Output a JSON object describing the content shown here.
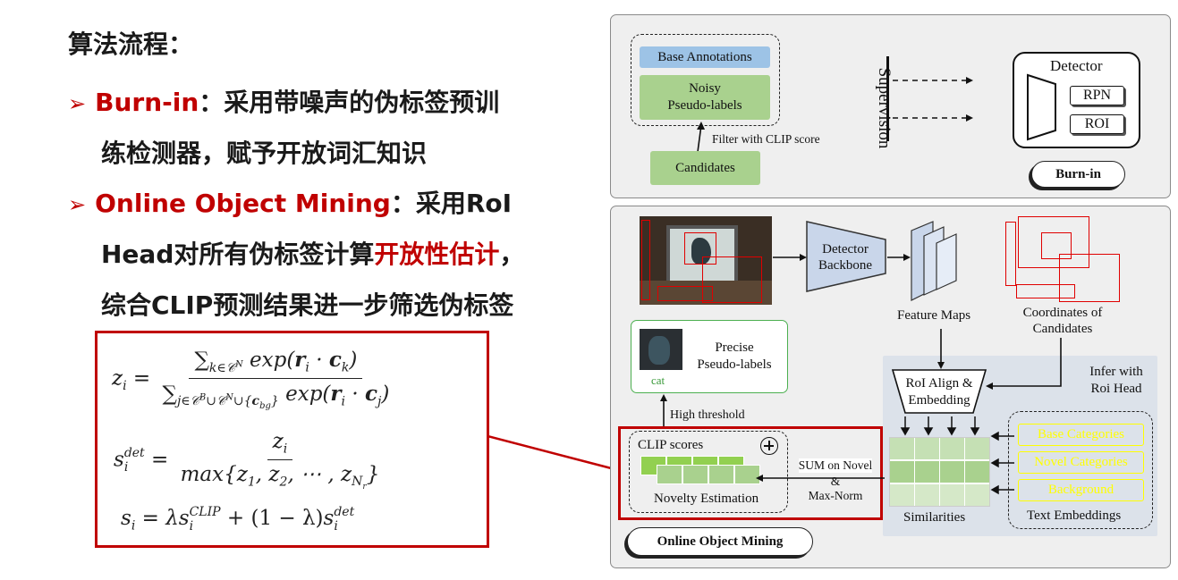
{
  "left": {
    "title": "算法流程：",
    "bullet1": {
      "highlight": "Burn-in",
      "rest": "：采用带噪声的伪标签预训",
      "line2": "练检测器，赋予开放词汇知识"
    },
    "bullet2": {
      "highlight": "Online Object Mining",
      "rest": "：采用RoI",
      "line2_pre": "Head对所有伪标签计算",
      "line2_red": "开放性估计",
      "line2_post": "，",
      "line3": "综合CLIP预测结果进一步筛选伪标签"
    }
  },
  "formulas": {
    "z_lhs": "z",
    "z_num": "exp(",
    "z_den": "exp(",
    "sdet_lhs": "s",
    "sdet_num": "z",
    "sdet_den": "max{z",
    "s_lhs": "s",
    "lambda": "λ",
    "one_minus_lambda": "(1 − λ)"
  },
  "burnin": {
    "base_annotations": "Base Annotations",
    "noisy_line1": "Noisy",
    "noisy_line2": "Pseudo-labels",
    "filter": "Filter with CLIP score",
    "candidates": "Candidates",
    "supervision": "Supervision",
    "detector": "Detector",
    "rpn": "RPN",
    "roi": "ROI",
    "label": "Burn-in"
  },
  "mining": {
    "detector_backbone_line1": "Detector",
    "detector_backbone_line2": "Backbone",
    "feature_maps": "Feature Maps",
    "coords_line1": "Coordinates of",
    "coords_line2": "Candidates",
    "precise_line1": "Precise",
    "precise_line2": "Pseudo-labels",
    "cat": "cat",
    "high_threshold": "High threshold",
    "infer_line1": "Infer with",
    "infer_line2": "Roi Head",
    "roi_align_line1": "RoI Align &",
    "roi_align_line2": "Embedding",
    "clip_scores": "CLIP scores",
    "novelty": "Novelty Estimation",
    "sum_line1": "SUM on Novel",
    "sum_line2": "&",
    "sum_line3": "Max-Norm",
    "similarities": "Similarities",
    "base_categories": "Base Categories",
    "novel_categories": "Novel Categories",
    "background": "Background",
    "text_embeddings": "Text Embeddings",
    "label": "Online Object Mining"
  },
  "colors": {
    "accent_red": "#c00000",
    "green_fill": "#a9d18e",
    "blue_fill": "#9dc3e6",
    "yellow_text": "#ffff00"
  }
}
